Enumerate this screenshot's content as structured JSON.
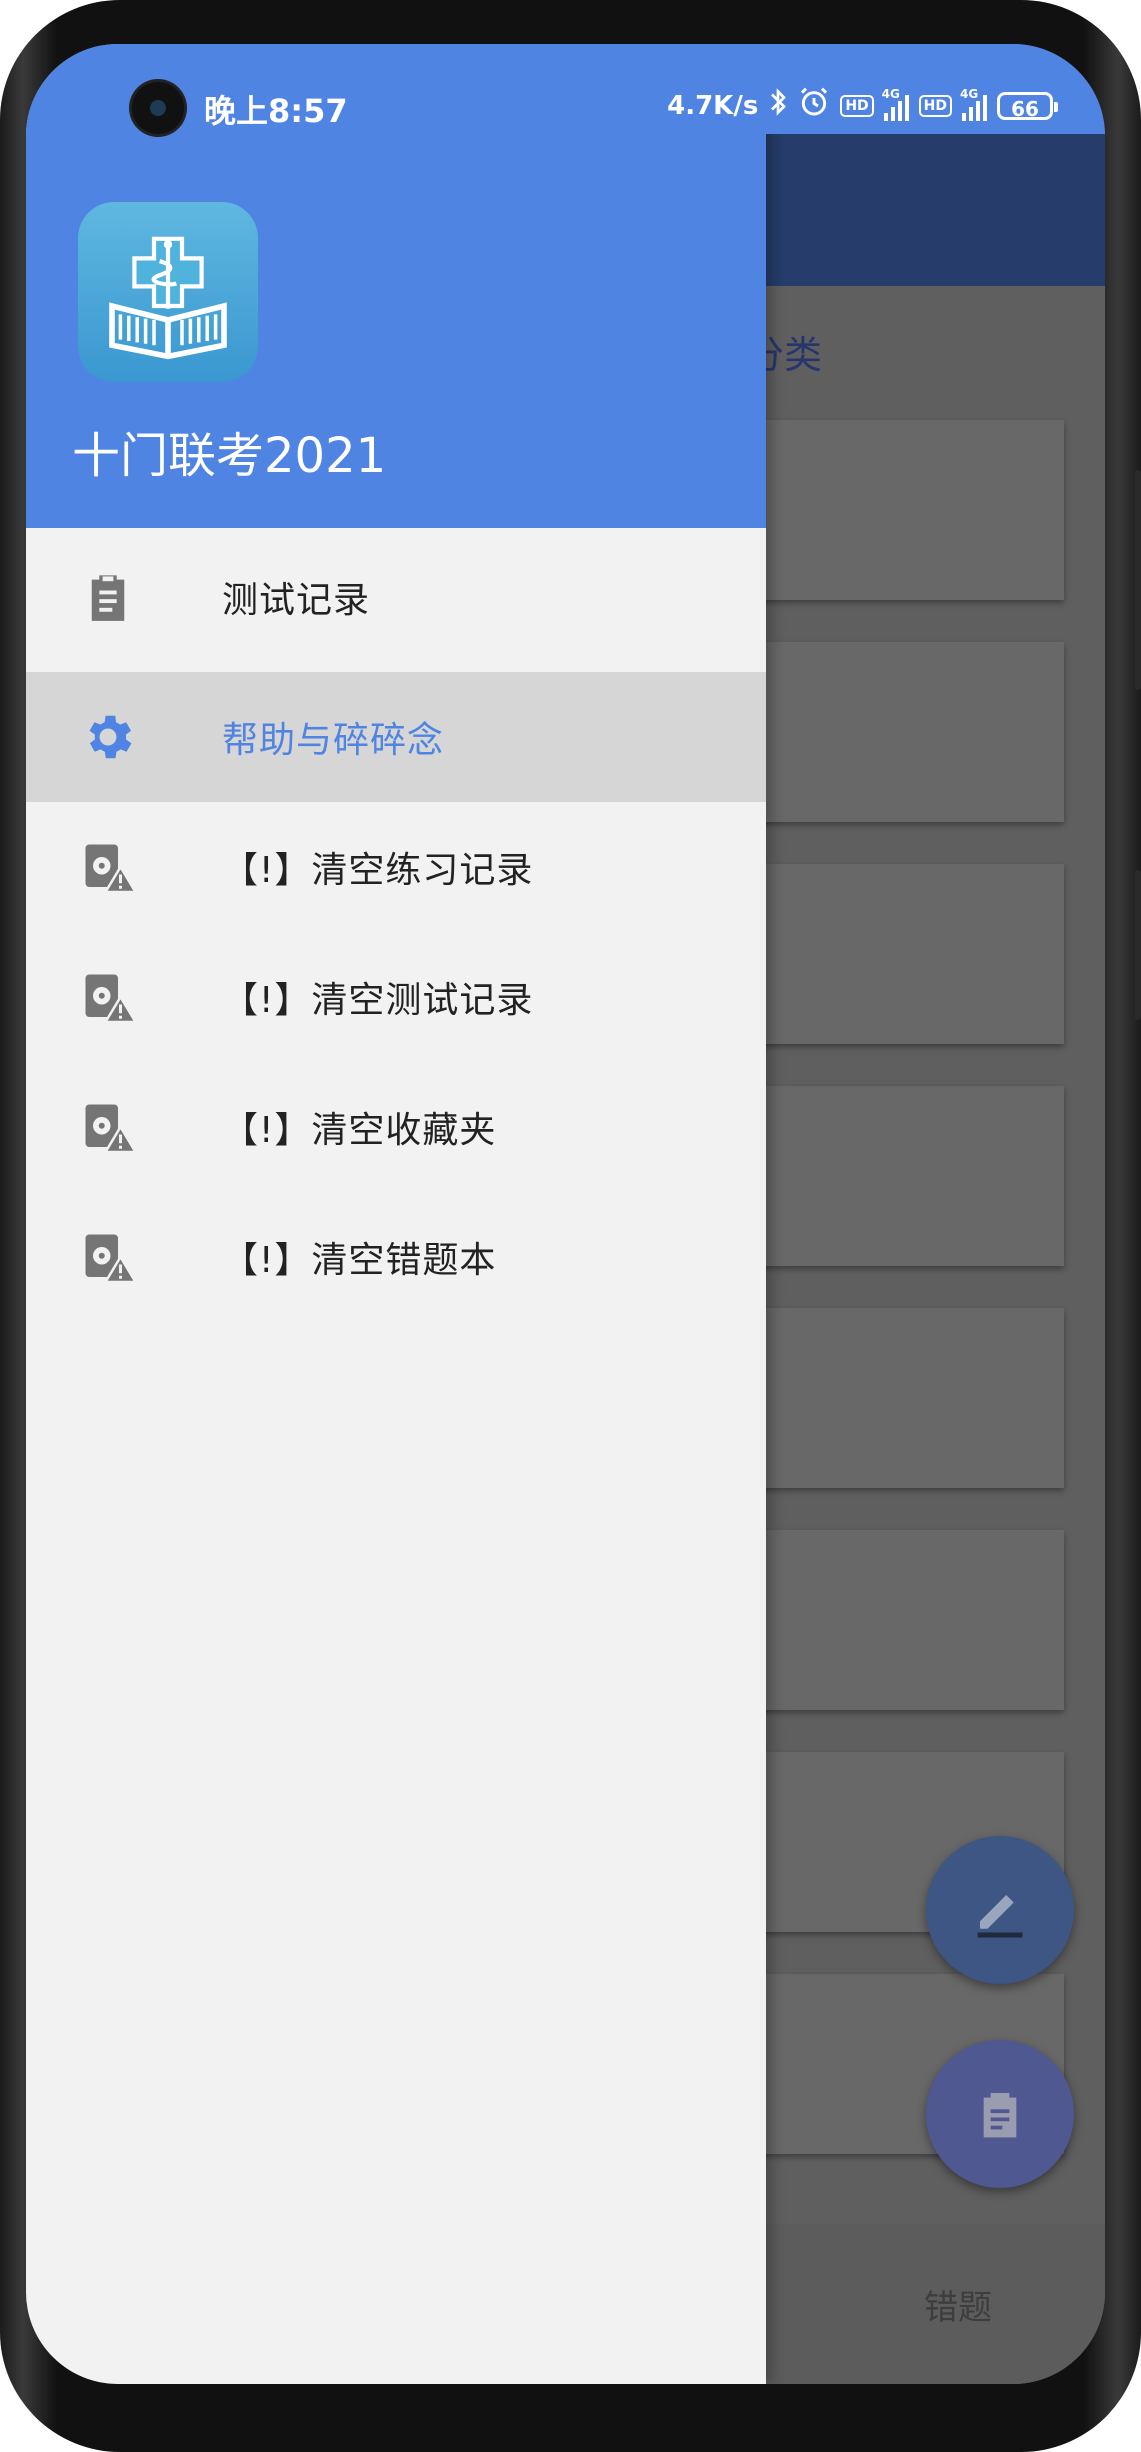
{
  "status_bar": {
    "time": "晚上8:57",
    "network_speed": "4.7K/s",
    "hd_badge": "HD",
    "signal_tech": "4G",
    "battery": "66",
    "icons": [
      "bluetooth-icon",
      "alarm-icon",
      "hd-icon",
      "signal-icon",
      "hd-icon",
      "signal-icon",
      "battery-icon"
    ]
  },
  "drawer": {
    "app_name": "十门联考2021",
    "app_icon": "medical-book-icon",
    "items": [
      {
        "label": "测试记录",
        "icon": "clipboard-icon",
        "active": false
      },
      {
        "label": "帮助与碎碎念",
        "icon": "gear-icon",
        "active": true
      },
      {
        "label": "【!】清空练习记录",
        "icon": "clear-data-warning-icon",
        "active": false
      },
      {
        "label": "【!】清空测试记录",
        "icon": "clear-data-warning-icon",
        "active": false
      },
      {
        "label": "【!】清空收藏夹",
        "icon": "clear-data-warning-icon",
        "active": false
      },
      {
        "label": "【!】清空错题本",
        "icon": "clear-data-warning-icon",
        "active": false
      }
    ]
  },
  "background_app": {
    "section_label": "分类",
    "bottom_tab_label": "错题",
    "fab_edit_icon": "edit-icon",
    "fab_clipboard_icon": "clipboard-icon"
  },
  "colors": {
    "primary": "#4f84e3",
    "drawer_bg": "#f2f2f2",
    "active_item_bg": "#d6d6d6",
    "toolbar_dim": "#263c6a"
  }
}
